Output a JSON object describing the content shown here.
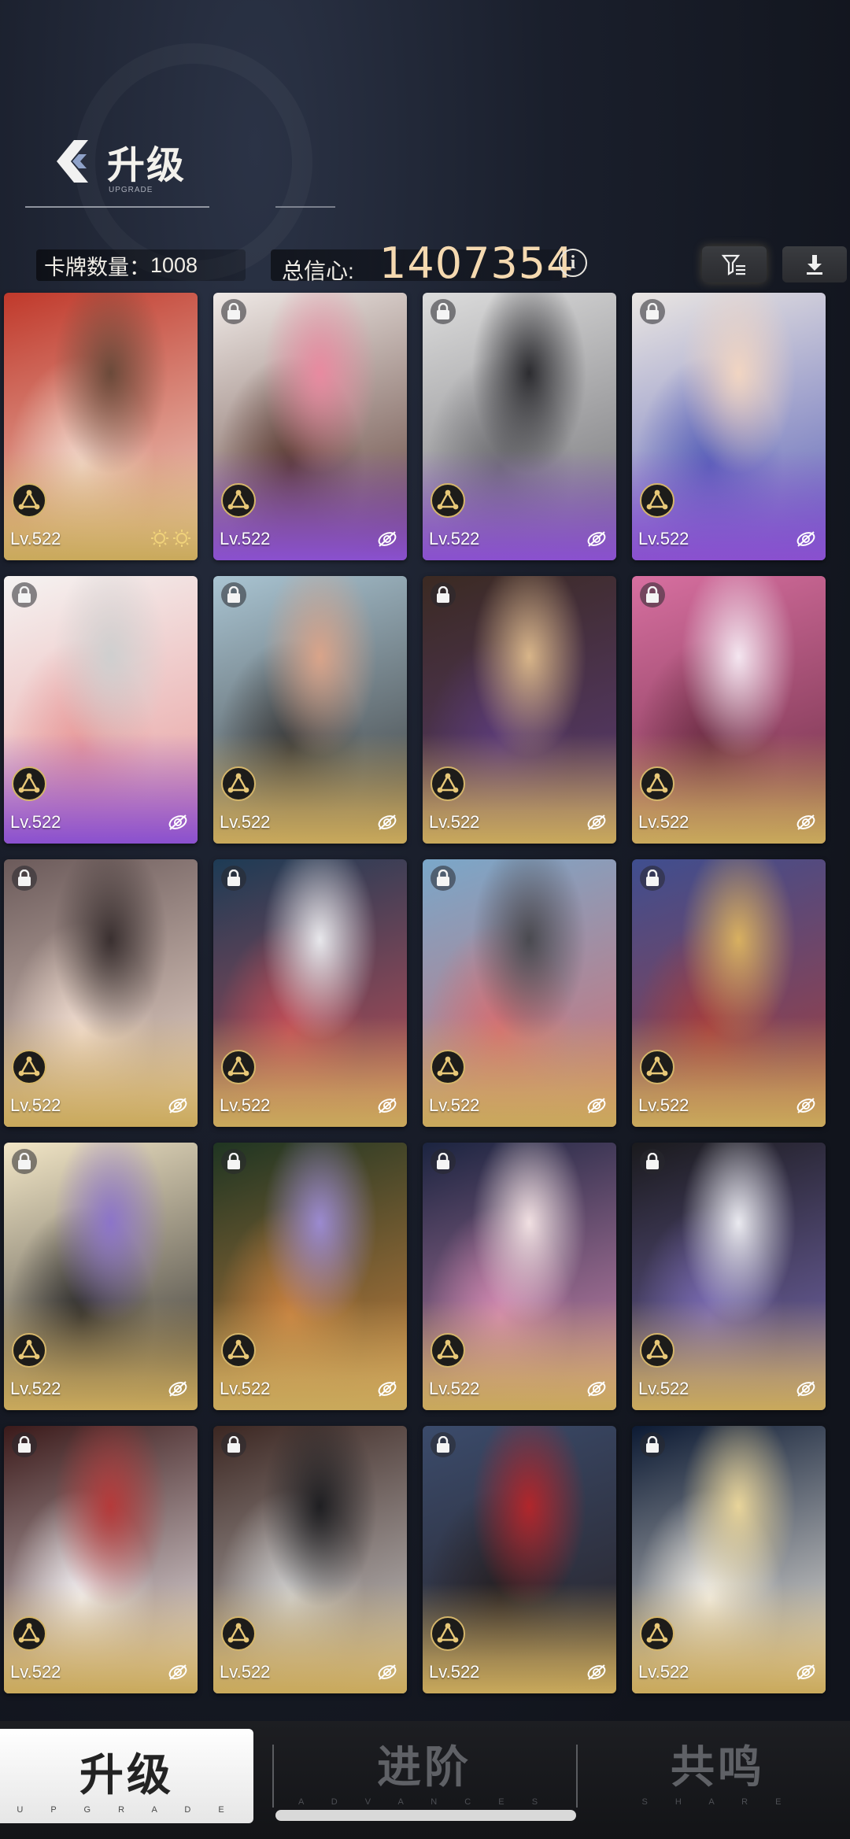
{
  "header": {
    "title": "升级",
    "subtitle": "UPGRADE"
  },
  "stats": {
    "card_count_label": "卡牌数量：",
    "card_count_value": "1008",
    "confidence_label": "总信心:",
    "confidence_value": "1407354"
  },
  "colors": {
    "accent_gold": "#c9a95b",
    "accent_purple": "#8a50cf",
    "confidence_text": "#f5d9b0"
  },
  "cards": [
    {
      "level": "Lv.522",
      "rarity": "gold",
      "locked": false,
      "icon": "stars",
      "art": [
        "#c0392b",
        "#f1d6c9",
        "#6b4a3a"
      ]
    },
    {
      "level": "Lv.522",
      "rarity": "purple",
      "locked": true,
      "icon": "link",
      "art": [
        "#efe9e6",
        "#5b3b33",
        "#e88aa0"
      ]
    },
    {
      "level": "Lv.522",
      "rarity": "purple",
      "locked": true,
      "icon": "link",
      "art": [
        "#dcdcdc",
        "#6e6e72",
        "#2c2c30"
      ]
    },
    {
      "level": "Lv.522",
      "rarity": "purple",
      "locked": true,
      "icon": "link",
      "art": [
        "#eae6e2",
        "#5860b8",
        "#f1d5c2"
      ]
    },
    {
      "level": "Lv.522",
      "rarity": "purple",
      "locked": true,
      "icon": "link",
      "art": [
        "#f5f3f2",
        "#e89a9a",
        "#cfcfcf"
      ]
    },
    {
      "level": "Lv.522",
      "rarity": "gold",
      "locked": true,
      "icon": "link",
      "art": [
        "#a9c4d2",
        "#3a3a3a",
        "#d9a48a"
      ]
    },
    {
      "level": "Lv.522",
      "rarity": "gold",
      "locked": true,
      "icon": "link",
      "art": [
        "#3b2a22",
        "#5b3b78",
        "#d8b589"
      ]
    },
    {
      "level": "Lv.522",
      "rarity": "gold",
      "locked": true,
      "icon": "link",
      "art": [
        "#d76fa0",
        "#6d2e45",
        "#f4e6f0"
      ]
    },
    {
      "level": "Lv.522",
      "rarity": "gold",
      "locked": true,
      "icon": "link",
      "art": [
        "#6b5a5a",
        "#f1ddd0",
        "#3a3030"
      ]
    },
    {
      "level": "Lv.522",
      "rarity": "gold",
      "locked": true,
      "icon": "link",
      "art": [
        "#1d3b55",
        "#c24d57",
        "#e8e8ec"
      ]
    },
    {
      "level": "Lv.522",
      "rarity": "gold",
      "locked": true,
      "icon": "link",
      "art": [
        "#7aa7c9",
        "#d46e72",
        "#4a4a50"
      ]
    },
    {
      "level": "Lv.522",
      "rarity": "gold",
      "locked": true,
      "icon": "link",
      "art": [
        "#3f4e8f",
        "#a53d3d",
        "#d8b060"
      ]
    },
    {
      "level": "Lv.522",
      "rarity": "gold",
      "locked": true,
      "icon": "link",
      "art": [
        "#f2e6c6",
        "#2d2c2c",
        "#8c74c9"
      ]
    },
    {
      "level": "Lv.522",
      "rarity": "gold",
      "locked": true,
      "icon": "link",
      "art": [
        "#1f3522",
        "#c7803f",
        "#9b8ad0"
      ]
    },
    {
      "level": "Lv.522",
      "rarity": "gold",
      "locked": true,
      "icon": "link",
      "art": [
        "#1b2440",
        "#d38ab2",
        "#f1e0e2"
      ]
    },
    {
      "level": "Lv.522",
      "rarity": "gold",
      "locked": true,
      "icon": "link",
      "art": [
        "#1a1a1d",
        "#7a6bb3",
        "#eaeaf0"
      ]
    },
    {
      "level": "Lv.522",
      "rarity": "gold",
      "locked": true,
      "icon": "link",
      "art": [
        "#3b1a1a",
        "#f3f0f3",
        "#b53a3a"
      ]
    },
    {
      "level": "Lv.522",
      "rarity": "gold",
      "locked": true,
      "icon": "link",
      "art": [
        "#3c2722",
        "#cfcfcf",
        "#1f1f22"
      ]
    },
    {
      "level": "Lv.522",
      "rarity": "gold",
      "locked": true,
      "icon": "link",
      "art": [
        "#3b4b6b",
        "#262023",
        "#b1262b"
      ]
    },
    {
      "level": "Lv.522",
      "rarity": "gold",
      "locked": true,
      "icon": "link",
      "art": [
        "#0c1a33",
        "#f5f1e8",
        "#e8d49a"
      ]
    }
  ],
  "tabs": [
    {
      "label": "升级",
      "sub": "U P G R A D E",
      "active": true
    },
    {
      "label": "进阶",
      "sub": "A D V A N C E S",
      "active": false
    },
    {
      "label": "共鸣",
      "sub": "S H A R E",
      "active": false
    }
  ]
}
